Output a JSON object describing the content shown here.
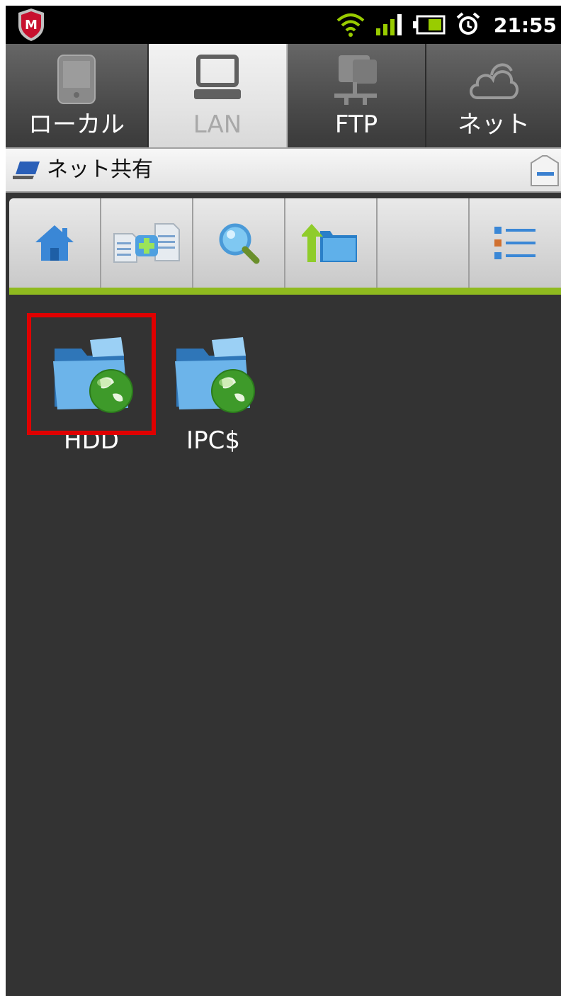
{
  "status_bar": {
    "time": "21:55",
    "icons": [
      "mcafee-shield-icon",
      "wifi-icon",
      "signal-icon",
      "battery-icon",
      "alarm-icon"
    ],
    "colors": {
      "wifi": "#99cc00",
      "signal": "#99cc00",
      "battery": "#99cc00"
    }
  },
  "tabs": [
    {
      "label": "ローカル",
      "icon": "phone-icon",
      "active": false
    },
    {
      "label": "LAN",
      "icon": "laptop-icon",
      "active": true
    },
    {
      "label": "FTP",
      "icon": "ftp-server-icon",
      "active": false
    },
    {
      "label": "ネット",
      "icon": "cloud-icon",
      "active": false
    }
  ],
  "path": {
    "title": "ネット共有",
    "icon": "laptop-small-icon"
  },
  "toolbar": {
    "buttons": [
      "home-icon",
      "new-folder-icon",
      "search-icon",
      "up-folder-icon",
      "empty",
      "view-list-icon"
    ],
    "accent": "#8fba1f"
  },
  "shares": [
    {
      "label": "HDD",
      "icon": "network-folder-icon",
      "highlighted": true
    },
    {
      "label": "IPC$",
      "icon": "network-folder-icon",
      "highlighted": false
    }
  ],
  "colors": {
    "highlight": "#e00000",
    "background": "#333333"
  }
}
